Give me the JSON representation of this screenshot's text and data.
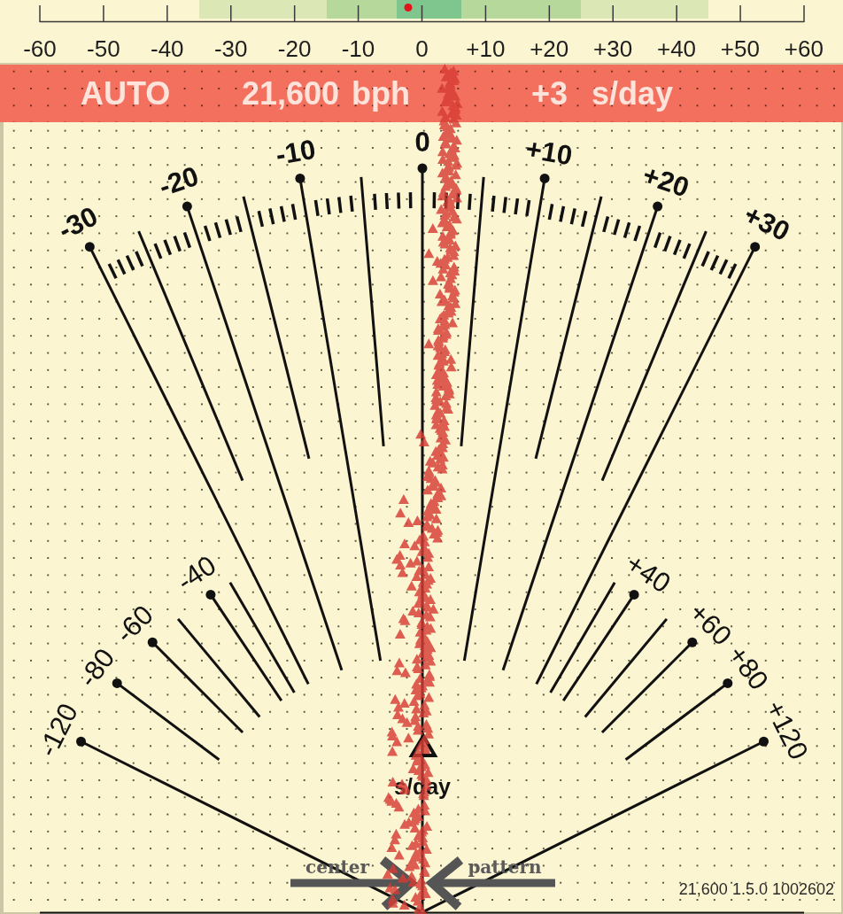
{
  "rate_scale": {
    "ticks": [
      "-60",
      "-50",
      "-40",
      "-30",
      "-20",
      "-10",
      "0",
      "+10",
      "+20",
      "+30",
      "+40",
      "+50",
      "+60"
    ],
    "marker": {
      "level": 0.482
    }
  },
  "status_bar": {
    "mode": "AUTO",
    "beat_rate": {
      "value": "21,600",
      "unit": "bph"
    },
    "rate": {
      "value": "+3",
      "unit": "s/day"
    }
  },
  "dial": {
    "upper_labels": [
      "-30",
      "-20",
      "-10",
      "0",
      "+10",
      "+20",
      "+30"
    ],
    "lower_labels": [
      "-120",
      "-80",
      "-60",
      "-40",
      "+40",
      "+60",
      "+80",
      "+120"
    ],
    "unit": "s/day"
  },
  "legend": [
    {
      "label": "center",
      "kind": "right"
    },
    {
      "label": "pattern",
      "kind": "left"
    }
  ],
  "version": "21,600 1.5.0 1002602"
}
